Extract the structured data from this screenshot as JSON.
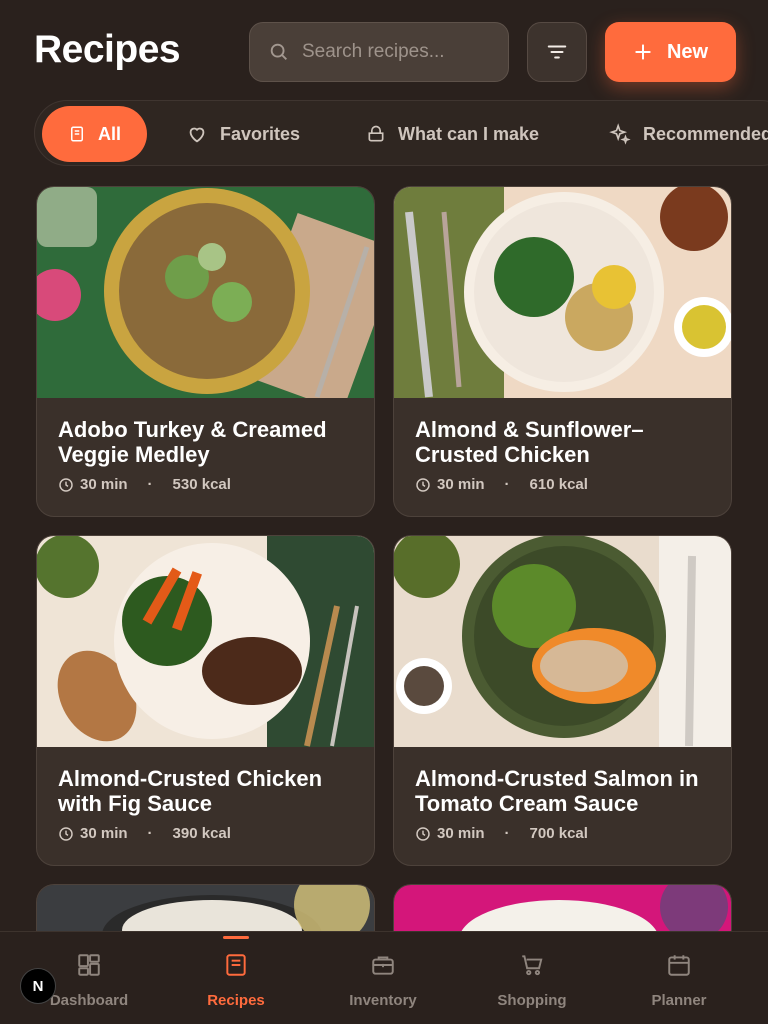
{
  "header": {
    "title": "Recipes",
    "search_placeholder": "Search recipes...",
    "filter_icon": "filter-lines-icon",
    "new_label": "New"
  },
  "tabs": [
    {
      "label": "All",
      "icon": "book-icon",
      "active": true
    },
    {
      "label": "Favorites",
      "icon": "heart-icon",
      "active": false
    },
    {
      "label": "What can I make",
      "icon": "pot-icon",
      "active": false
    },
    {
      "label": "Recommended",
      "icon": "sparkle-icon",
      "active": false
    }
  ],
  "recipes": [
    {
      "title": "Adobo Turkey & Creamed Veggie Medley",
      "time": "30 min",
      "kcal": "530 kcal"
    },
    {
      "title": "Almond & Sunflower–Crusted Chicken",
      "time": "30 min",
      "kcal": "610 kcal"
    },
    {
      "title": "Almond-Crusted Chicken with Fig Sauce",
      "time": "30 min",
      "kcal": "390 kcal"
    },
    {
      "title": "Almond-Crusted Salmon in Tomato Cream Sauce",
      "time": "30 min",
      "kcal": "700 kcal"
    }
  ],
  "meta_separator": "·",
  "bottom_nav": [
    {
      "label": "Dashboard",
      "icon": "dashboard-icon",
      "active": false
    },
    {
      "label": "Recipes",
      "icon": "recipe-book-icon",
      "active": true
    },
    {
      "label": "Inventory",
      "icon": "briefcase-icon",
      "active": false
    },
    {
      "label": "Shopping",
      "icon": "cart-icon",
      "active": false
    },
    {
      "label": "Planner",
      "icon": "calendar-icon",
      "active": false
    }
  ],
  "dev_badge": "N",
  "colors": {
    "background": "#2a211d",
    "accent": "#ff6b3d",
    "card": "#3a302a"
  }
}
